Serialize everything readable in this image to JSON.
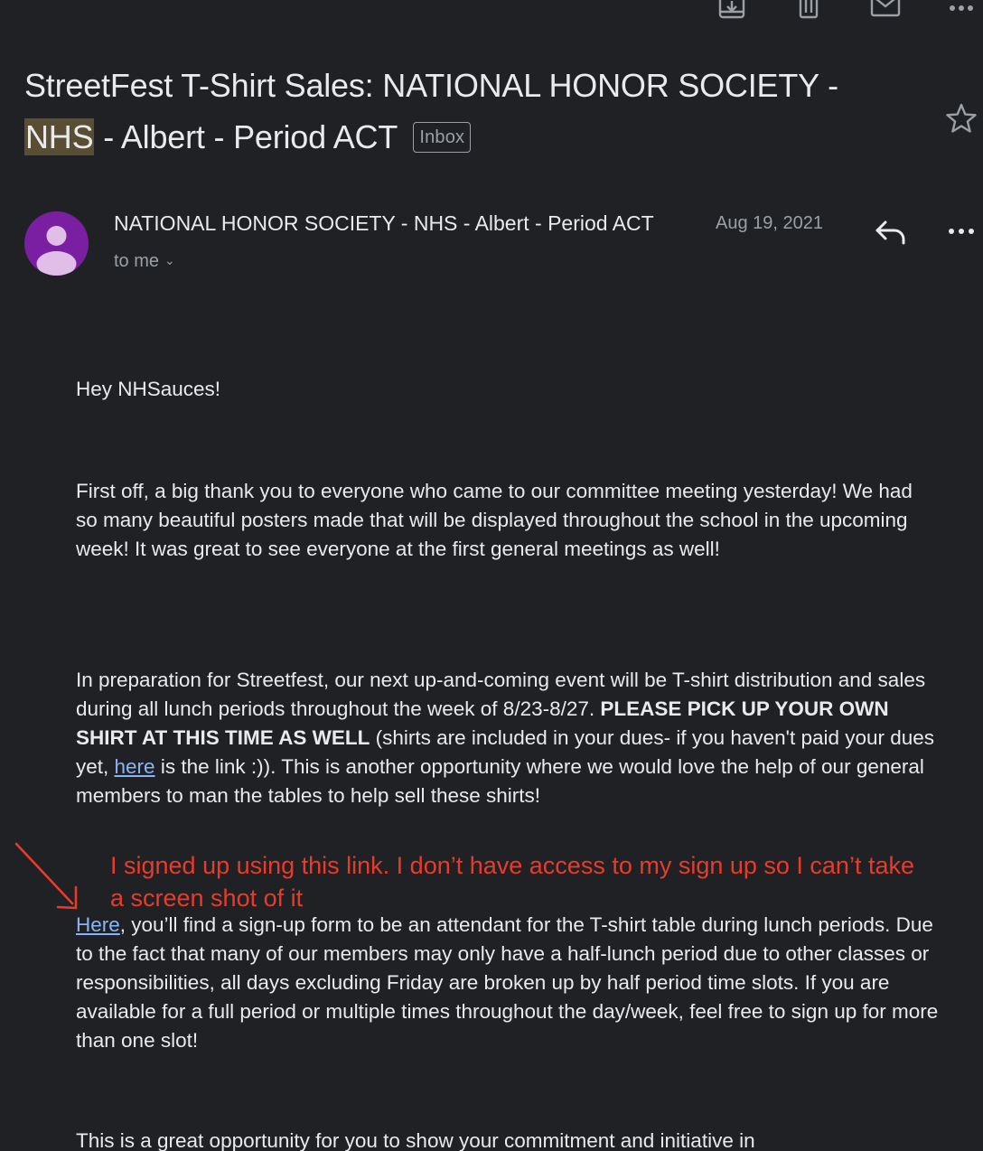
{
  "toolbar": {
    "icons": [
      "archive-icon",
      "delete-icon",
      "mark-unread-icon",
      "more-options-icon"
    ]
  },
  "email": {
    "subject_part1": "StreetFest T-Shirt Sales: NATIONAL HONOR SOCIETY -",
    "subject_highlight": "NHS",
    "subject_part2": " - Albert - Period ACT",
    "label": "Inbox",
    "sender": "NATIONAL HONOR SOCIETY - NHS - Albert - Period ACT",
    "date": "Aug 19, 2021",
    "recipient": "to me",
    "avatar_color": "#7b1fa2"
  },
  "body": {
    "greeting": "Hey NHSauces!",
    "para1": "First off, a big thank you to everyone who came to our committee meeting yesterday! We had so many beautiful posters made that will be displayed throughout the school in the upcoming week!  It was great to see everyone at the first general meetings as well!",
    "para2_a": "In preparation for Streetfest, our next up-and-coming event will be T-shirt distribution and sales during all lunch periods throughout the week of 8/23-8/27.  ",
    "para2_bold": "PLEASE PICK UP YOUR OWN SHIRT AT THIS TIME AS WELL",
    "para2_b": " (shirts are included in your dues- if you haven't paid your dues yet, ",
    "para2_link": "here",
    "para2_c": " is the link :)). This is another opportunity where we would love the help of our general members to man the tables to help sell these shirts!",
    "para3_link": "Here",
    "para3_rest": ", you’ll find a sign-up form to be an attendant for the T-shirt table during lunch periods. Due to the fact that many of our members may only have a half-lunch period due to other classes or responsibilities, all days excluding Friday are broken up by half period time slots. If you are available for a full period or multiple times throughout the day/week, feel free to sign up for more than one slot!",
    "para4": "This is a great opportunity for you to show your commitment and initiative in"
  },
  "annotation": {
    "text": "I signed up using this link. I don’t have access to my sign up so I can’t take a screen shot of it",
    "color": "#ea3b2a"
  }
}
